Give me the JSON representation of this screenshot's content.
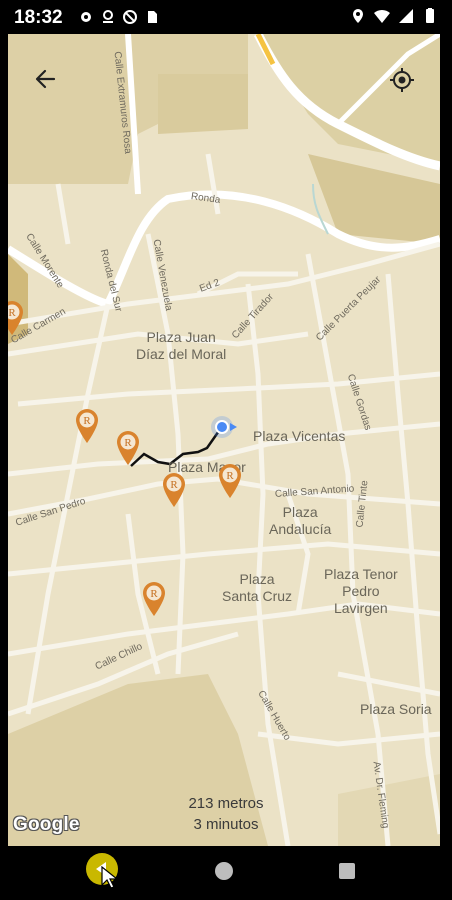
{
  "status_bar": {
    "time": "18:32",
    "left_icons": [
      "settings-icon",
      "location-alt-icon",
      "vpn-icon",
      "sim-icon"
    ],
    "right_icons": [
      "location-icon",
      "wifi-icon",
      "signal-icon",
      "battery-icon"
    ]
  },
  "toolbar": {
    "back_icon": "arrow-back-icon",
    "locate_icon": "my-location-icon"
  },
  "map": {
    "streets": [
      "Calle Extramuros Rosa",
      "Ronda",
      "Calle Morente",
      "Ronda del Sur",
      "Calle Venezuela",
      "Ed 2",
      "Calle Tirador",
      "Calle Puerta Peujar",
      "Calle Carmen",
      "Calle Gordas",
      "Calle San Pedro",
      "Calle San Antonio",
      "Calle Tinte",
      "Calle Chillo",
      "Calle Huerto",
      "Av. Dr. Fleming"
    ],
    "places": [
      "Plaza Juan\nDíaz del Moral",
      "Plaza Vicentas",
      "Plaza Mayor",
      "Plaza\nAndalucía",
      "Plaza\nSanta Cruz",
      "Plaza Tenor\nPedro\nLavirgen",
      "Plaza Soria"
    ],
    "pin_letter": "R",
    "colors": {
      "background": "#ebe2c6",
      "road": "#f7f4ea",
      "major_road": "#ffffff",
      "block": "#ddd0a6",
      "pin": "#d9832d",
      "route": "#111111",
      "user_dot": "#4a8af4"
    }
  },
  "route_info": {
    "distance": "213 metros",
    "duration": "3 minutos"
  },
  "google_logo": "Google",
  "nav_bar": {
    "back": "nav-back-button",
    "home": "nav-home-button",
    "recents": "nav-recents-button"
  }
}
